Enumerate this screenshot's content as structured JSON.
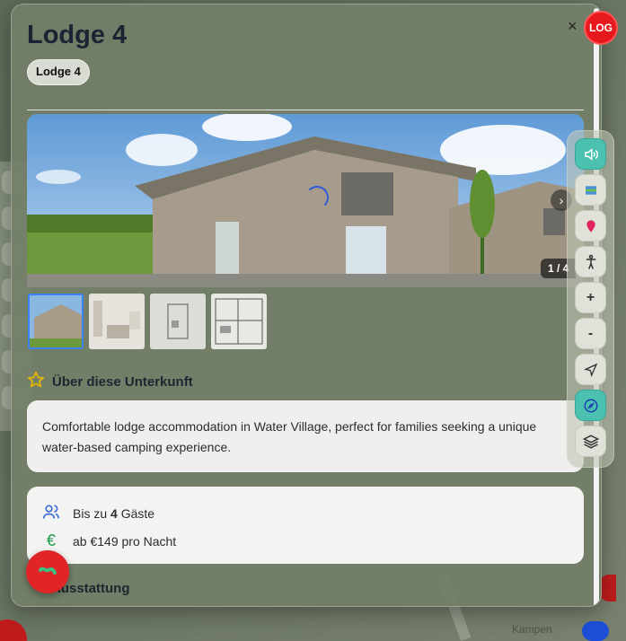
{
  "lodge": {
    "title": "Lodge 4",
    "chip": "Lodge 4",
    "close": "×",
    "image_counter": "1 / 4",
    "next_arrow": "›"
  },
  "about": {
    "heading": "Über diese Unterkunft",
    "description": "Comfortable lodge accommodation in Water Village, perfect for families seeking a unique water-based camping experience."
  },
  "info": {
    "guests_prefix": "Bis zu ",
    "guests_count": "4",
    "guests_suffix": " Gäste",
    "price": "ab €149 pro Nacht"
  },
  "amenities": {
    "heading": "Ausstattung"
  },
  "log_button": "LOG",
  "toolbar": {
    "buttons": [
      "speaker-icon",
      "map-icon",
      "pin-icon",
      "accessibility-icon",
      "zoom-in-icon",
      "zoom-out-icon",
      "navigate-icon",
      "compass-icon",
      "layers-icon"
    ],
    "zoom_in": "+",
    "zoom_out": "-"
  },
  "map": {
    "place_label": "Kampen"
  },
  "colors": {
    "accent_red": "#e8191d",
    "accent_teal": "#4bc2b0",
    "active_thumb_border": "#3b82f6"
  }
}
